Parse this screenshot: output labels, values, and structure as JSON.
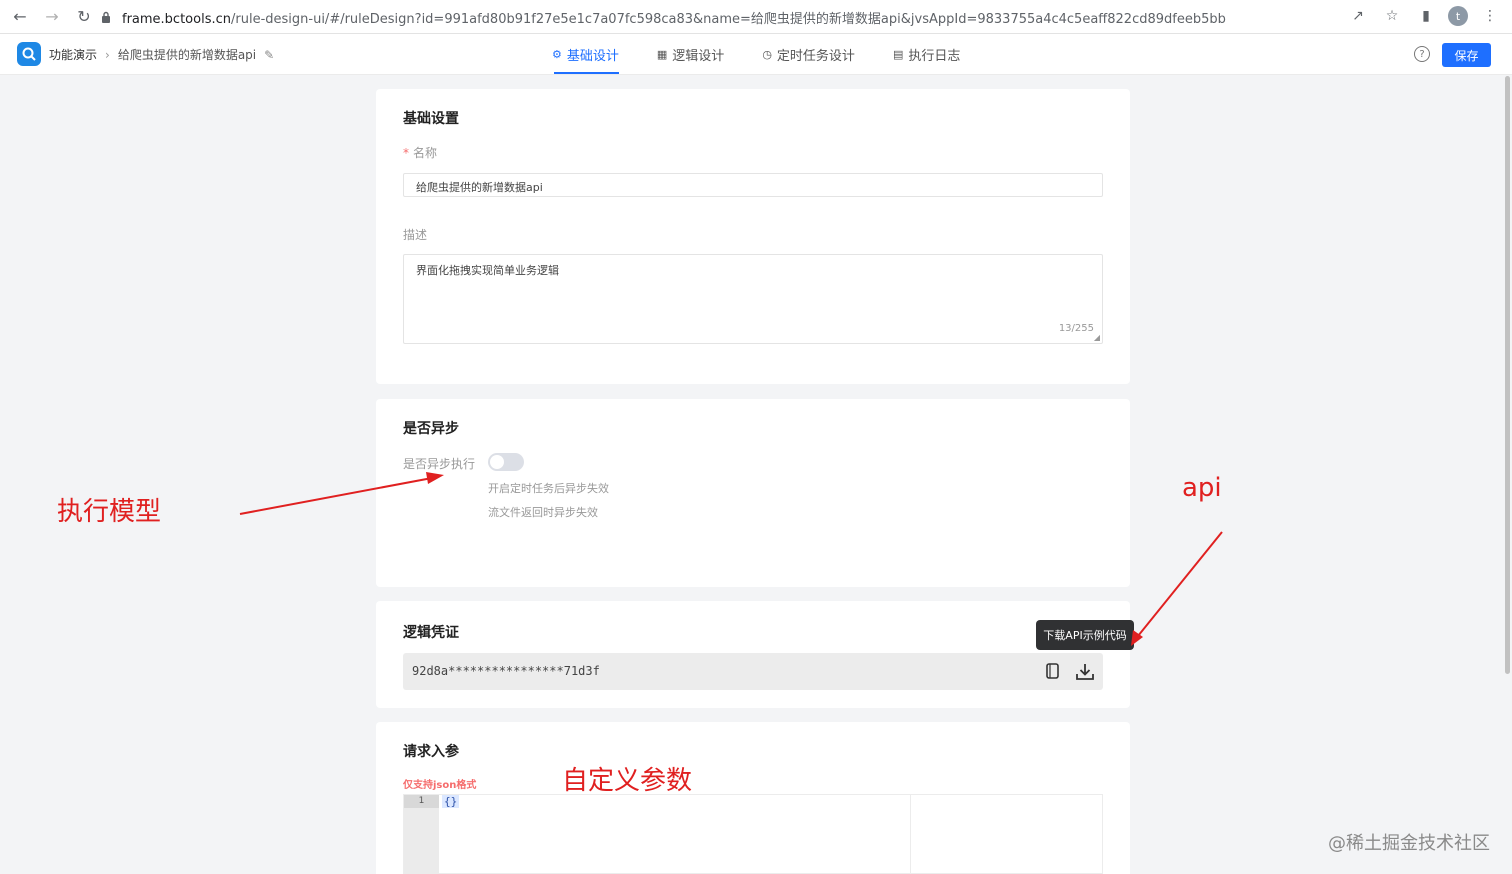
{
  "browser": {
    "url_host": "frame.bctools.cn",
    "url_rest": "/rule-design-ui/#/ruleDesign?id=991afd80b91f27e5e1c7a07fc598ca83&name=给爬虫提供的新增数据api&jvsAppId=9833755a4c4c5eaff822cd89dfeeb5bb",
    "profile_initial": "t"
  },
  "header": {
    "app_name": "功能演示",
    "rule_name": "给爬虫提供的新增数据api",
    "tabs": [
      {
        "label": "基础设计",
        "icon": "gear-icon"
      },
      {
        "label": "逻辑设计",
        "icon": "grid-icon"
      },
      {
        "label": "定时任务设计",
        "icon": "clock-icon"
      },
      {
        "label": "执行日志",
        "icon": "document-icon"
      }
    ],
    "save_label": "保存",
    "help_label": "?"
  },
  "basic": {
    "title": "基础设置",
    "required_mark": "*",
    "name_label": "名称",
    "name_value": "给爬虫提供的新增数据api",
    "desc_label": "描述",
    "desc_value": "界面化拖拽实现简单业务逻辑",
    "desc_count": "13/255"
  },
  "async": {
    "title": "是否异步",
    "switch_label": "是否异步执行",
    "switch_on": false,
    "hint1": "开启定时任务后异步失效",
    "hint2": "流文件返回时异步失效"
  },
  "credential": {
    "title": "逻辑凭证",
    "value": "92d8a****************71d3f",
    "tooltip": "下载API示例代码"
  },
  "params": {
    "title": "请求入参",
    "note": "仅支持json格式",
    "line_no": "1",
    "code": "{}"
  },
  "annotations": {
    "exec_model": "执行模型",
    "api": "api",
    "custom_params": "自定义参数",
    "color": "#e02020"
  },
  "watermark": "@稀土掘金技术社区"
}
